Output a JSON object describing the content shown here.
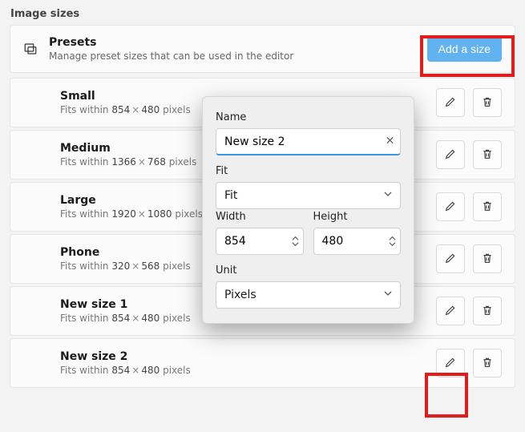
{
  "section_title": "Image sizes",
  "header": {
    "title": "Presets",
    "subtitle": "Manage preset sizes that can be used in the editor",
    "add_label": "Add a size"
  },
  "row_sub_prefix": "Fits within",
  "row_sub_suffix": "pixels",
  "presets": [
    {
      "name": "Small",
      "w": "854",
      "h": "480"
    },
    {
      "name": "Medium",
      "w": "1366",
      "h": "768"
    },
    {
      "name": "Large",
      "w": "1920",
      "h": "1080"
    },
    {
      "name": "Phone",
      "w": "320",
      "h": "568"
    },
    {
      "name": "New size 1",
      "w": "854",
      "h": "480"
    },
    {
      "name": "New size 2",
      "w": "854",
      "h": "480"
    }
  ],
  "popup": {
    "name_label": "Name",
    "name_value": "New size 2",
    "fit_label": "Fit",
    "fit_value": "Fit",
    "width_label": "Width",
    "width_value": "854",
    "height_label": "Height",
    "height_value": "480",
    "unit_label": "Unit",
    "unit_value": "Pixels"
  }
}
